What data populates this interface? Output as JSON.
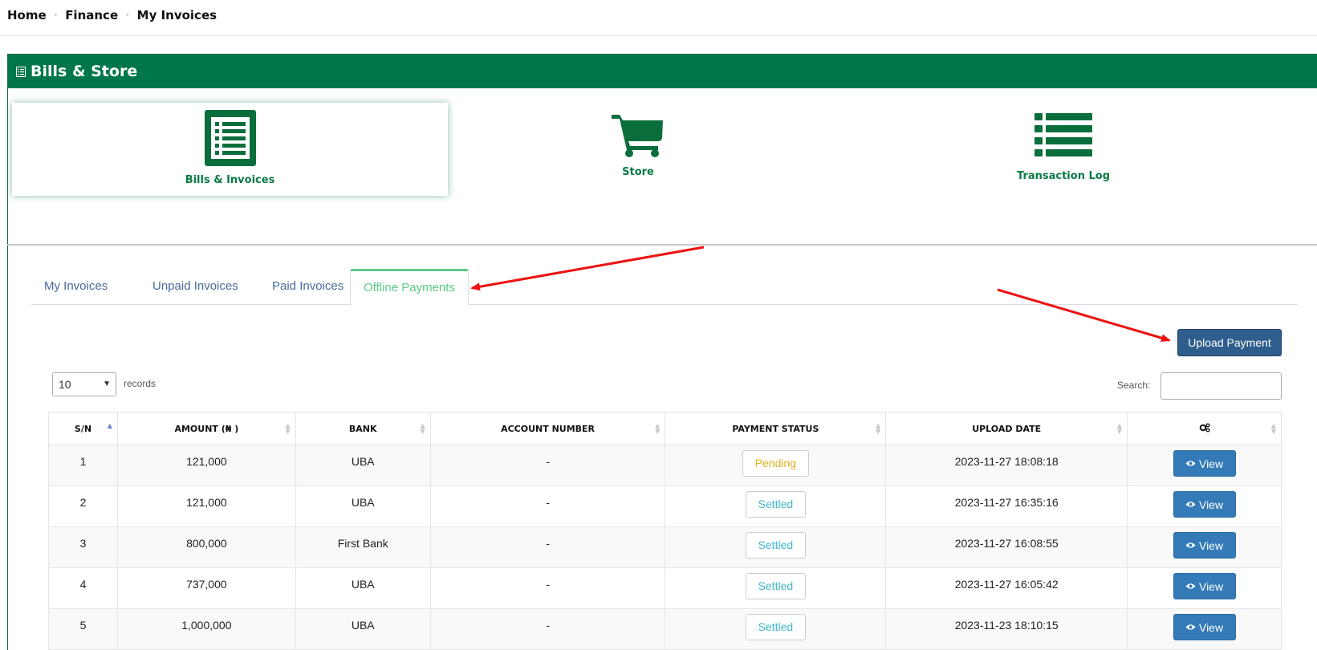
{
  "breadcrumb": {
    "items": [
      "Home",
      "Finance",
      "My Invoices"
    ],
    "separator": "•"
  },
  "panel": {
    "title": "Bills & Store",
    "accent": "#00774a"
  },
  "tiles": [
    {
      "label": "Bills & Invoices",
      "icon": "invoice-icon",
      "active": true
    },
    {
      "label": "Store",
      "icon": "shopping-cart-icon"
    },
    {
      "label": "Transaction Log",
      "icon": "list-icon"
    }
  ],
  "tabs": [
    {
      "label": "My Invoices"
    },
    {
      "label": "Unpaid Invoices"
    },
    {
      "label": "Paid Invoices"
    },
    {
      "label": "Offline Payments",
      "active": true
    }
  ],
  "upload_button": "Upload Payment",
  "table_controls": {
    "length_value": "10",
    "records_label": "records",
    "search_label": "Search:",
    "search_value": ""
  },
  "table": {
    "columns": [
      "S/N",
      "AMOUNT (₦ )",
      "BANK",
      "ACCOUNT NUMBER",
      "PAYMENT STATUS",
      "UPLOAD DATE",
      "gears-icon"
    ],
    "rows": [
      {
        "sn": "1",
        "amount": "121,000",
        "bank": "UBA",
        "account": "-",
        "status": "Pending",
        "date": "2023-11-27 18:08:18",
        "action": "View"
      },
      {
        "sn": "2",
        "amount": "121,000",
        "bank": "UBA",
        "account": "-",
        "status": "Settled",
        "date": "2023-11-27 16:35:16",
        "action": "View"
      },
      {
        "sn": "3",
        "amount": "800,000",
        "bank": "First Bank",
        "account": "-",
        "status": "Settled",
        "date": "2023-11-27 16:08:55",
        "action": "View"
      },
      {
        "sn": "4",
        "amount": "737,000",
        "bank": "UBA",
        "account": "-",
        "status": "Settled",
        "date": "2023-11-27 16:05:42",
        "action": "View"
      },
      {
        "sn": "5",
        "amount": "1,000,000",
        "bank": "UBA",
        "account": "-",
        "status": "Settled",
        "date": "2023-11-23 18:10:15",
        "action": "View"
      }
    ]
  },
  "colors": {
    "status_pending": "#e0b21a",
    "status_settled": "#3fb6c8",
    "view_button": "#337ab7",
    "upload_button": "#2e5e8e",
    "annotation_arrow": "#ee1111"
  }
}
